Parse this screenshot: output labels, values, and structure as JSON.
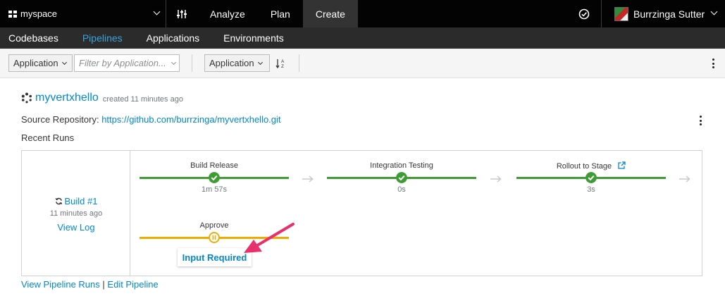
{
  "topbar": {
    "space_label": "myspace",
    "nav": [
      {
        "label": "Analyze"
      },
      {
        "label": "Plan"
      },
      {
        "label": "Create"
      }
    ],
    "user_name": "Burrzinga Sutter"
  },
  "subnav": {
    "items": [
      {
        "label": "Codebases"
      },
      {
        "label": "Pipelines"
      },
      {
        "label": "Applications"
      },
      {
        "label": "Environments"
      }
    ]
  },
  "toolbar": {
    "filter_type": "Application",
    "filter_placeholder": "Filter by Application...",
    "sort_field": "Application"
  },
  "pipeline": {
    "name": "myvertxhello",
    "created": "created 11 minutes ago",
    "source_label": "Source Repository:",
    "source_url": "https://github.com/burrzinga/myvertxhello.git",
    "recent_runs": "Recent Runs"
  },
  "build": {
    "title": "Build #1",
    "time": "11 minutes ago",
    "log": "View Log"
  },
  "stages": [
    {
      "name": "Build Release",
      "duration": "1m 57s",
      "status": "success"
    },
    {
      "name": "Integration Testing",
      "duration": "0s",
      "status": "success"
    },
    {
      "name": "Rollout to Stage",
      "duration": "3s",
      "status": "success"
    },
    {
      "name": "Approve",
      "duration": "",
      "status": "paused"
    }
  ],
  "approve_action": "Input Required",
  "links": {
    "view_runs": "View Pipeline Runs",
    "separator": "|",
    "edit": "Edit Pipeline"
  },
  "colors": {
    "success": "#3f9c35",
    "paused": "#f0ab00",
    "link": "#0088ce",
    "annotation_arrow": "#e8306c"
  },
  "icons": {
    "space": "grid-icon",
    "settings": "sliders-icon",
    "notifications": "check-circle-icon",
    "sort": "sort-alpha-icon",
    "pipeline": "spinner-icon",
    "build": "sync-icon",
    "external": "external-link-icon"
  }
}
